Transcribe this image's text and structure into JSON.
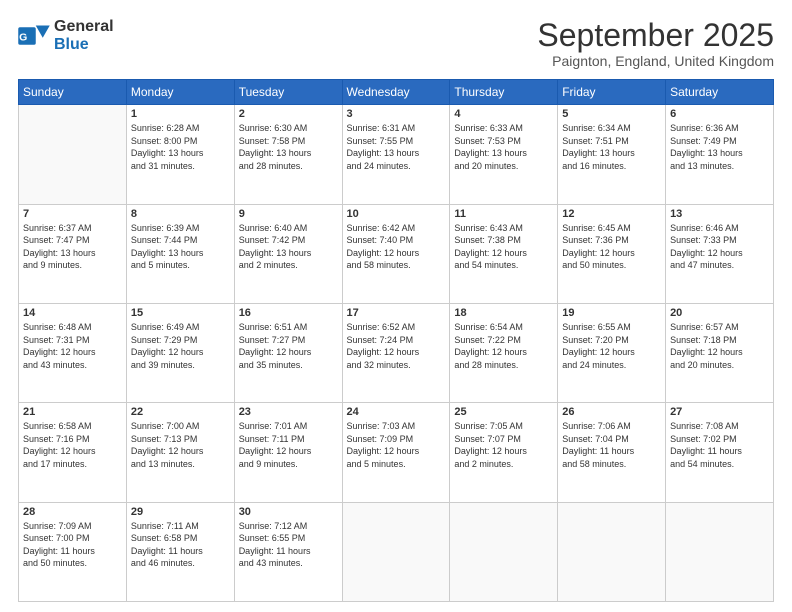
{
  "logo": {
    "line1": "General",
    "line2": "Blue"
  },
  "title": "September 2025",
  "location": "Paignton, England, United Kingdom",
  "days_of_week": [
    "Sunday",
    "Monday",
    "Tuesday",
    "Wednesday",
    "Thursday",
    "Friday",
    "Saturday"
  ],
  "weeks": [
    [
      {
        "day": "",
        "info": ""
      },
      {
        "day": "1",
        "info": "Sunrise: 6:28 AM\nSunset: 8:00 PM\nDaylight: 13 hours\nand 31 minutes."
      },
      {
        "day": "2",
        "info": "Sunrise: 6:30 AM\nSunset: 7:58 PM\nDaylight: 13 hours\nand 28 minutes."
      },
      {
        "day": "3",
        "info": "Sunrise: 6:31 AM\nSunset: 7:55 PM\nDaylight: 13 hours\nand 24 minutes."
      },
      {
        "day": "4",
        "info": "Sunrise: 6:33 AM\nSunset: 7:53 PM\nDaylight: 13 hours\nand 20 minutes."
      },
      {
        "day": "5",
        "info": "Sunrise: 6:34 AM\nSunset: 7:51 PM\nDaylight: 13 hours\nand 16 minutes."
      },
      {
        "day": "6",
        "info": "Sunrise: 6:36 AM\nSunset: 7:49 PM\nDaylight: 13 hours\nand 13 minutes."
      }
    ],
    [
      {
        "day": "7",
        "info": "Sunrise: 6:37 AM\nSunset: 7:47 PM\nDaylight: 13 hours\nand 9 minutes."
      },
      {
        "day": "8",
        "info": "Sunrise: 6:39 AM\nSunset: 7:44 PM\nDaylight: 13 hours\nand 5 minutes."
      },
      {
        "day": "9",
        "info": "Sunrise: 6:40 AM\nSunset: 7:42 PM\nDaylight: 13 hours\nand 2 minutes."
      },
      {
        "day": "10",
        "info": "Sunrise: 6:42 AM\nSunset: 7:40 PM\nDaylight: 12 hours\nand 58 minutes."
      },
      {
        "day": "11",
        "info": "Sunrise: 6:43 AM\nSunset: 7:38 PM\nDaylight: 12 hours\nand 54 minutes."
      },
      {
        "day": "12",
        "info": "Sunrise: 6:45 AM\nSunset: 7:36 PM\nDaylight: 12 hours\nand 50 minutes."
      },
      {
        "day": "13",
        "info": "Sunrise: 6:46 AM\nSunset: 7:33 PM\nDaylight: 12 hours\nand 47 minutes."
      }
    ],
    [
      {
        "day": "14",
        "info": "Sunrise: 6:48 AM\nSunset: 7:31 PM\nDaylight: 12 hours\nand 43 minutes."
      },
      {
        "day": "15",
        "info": "Sunrise: 6:49 AM\nSunset: 7:29 PM\nDaylight: 12 hours\nand 39 minutes."
      },
      {
        "day": "16",
        "info": "Sunrise: 6:51 AM\nSunset: 7:27 PM\nDaylight: 12 hours\nand 35 minutes."
      },
      {
        "day": "17",
        "info": "Sunrise: 6:52 AM\nSunset: 7:24 PM\nDaylight: 12 hours\nand 32 minutes."
      },
      {
        "day": "18",
        "info": "Sunrise: 6:54 AM\nSunset: 7:22 PM\nDaylight: 12 hours\nand 28 minutes."
      },
      {
        "day": "19",
        "info": "Sunrise: 6:55 AM\nSunset: 7:20 PM\nDaylight: 12 hours\nand 24 minutes."
      },
      {
        "day": "20",
        "info": "Sunrise: 6:57 AM\nSunset: 7:18 PM\nDaylight: 12 hours\nand 20 minutes."
      }
    ],
    [
      {
        "day": "21",
        "info": "Sunrise: 6:58 AM\nSunset: 7:16 PM\nDaylight: 12 hours\nand 17 minutes."
      },
      {
        "day": "22",
        "info": "Sunrise: 7:00 AM\nSunset: 7:13 PM\nDaylight: 12 hours\nand 13 minutes."
      },
      {
        "day": "23",
        "info": "Sunrise: 7:01 AM\nSunset: 7:11 PM\nDaylight: 12 hours\nand 9 minutes."
      },
      {
        "day": "24",
        "info": "Sunrise: 7:03 AM\nSunset: 7:09 PM\nDaylight: 12 hours\nand 5 minutes."
      },
      {
        "day": "25",
        "info": "Sunrise: 7:05 AM\nSunset: 7:07 PM\nDaylight: 12 hours\nand 2 minutes."
      },
      {
        "day": "26",
        "info": "Sunrise: 7:06 AM\nSunset: 7:04 PM\nDaylight: 11 hours\nand 58 minutes."
      },
      {
        "day": "27",
        "info": "Sunrise: 7:08 AM\nSunset: 7:02 PM\nDaylight: 11 hours\nand 54 minutes."
      }
    ],
    [
      {
        "day": "28",
        "info": "Sunrise: 7:09 AM\nSunset: 7:00 PM\nDaylight: 11 hours\nand 50 minutes."
      },
      {
        "day": "29",
        "info": "Sunrise: 7:11 AM\nSunset: 6:58 PM\nDaylight: 11 hours\nand 46 minutes."
      },
      {
        "day": "30",
        "info": "Sunrise: 7:12 AM\nSunset: 6:55 PM\nDaylight: 11 hours\nand 43 minutes."
      },
      {
        "day": "",
        "info": ""
      },
      {
        "day": "",
        "info": ""
      },
      {
        "day": "",
        "info": ""
      },
      {
        "day": "",
        "info": ""
      }
    ]
  ]
}
